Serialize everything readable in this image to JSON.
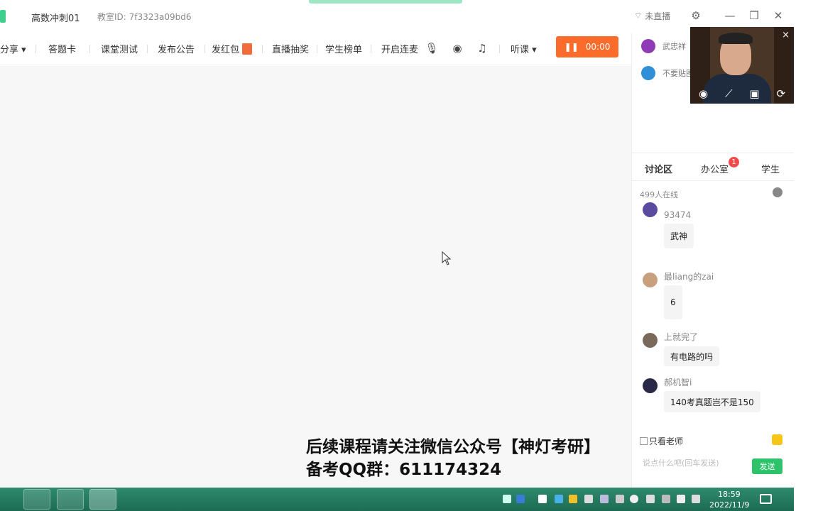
{
  "window": {
    "course_name": "高数冲刺01",
    "room_id": "教室ID: 7f3323a09bd6",
    "live_status": "未直播"
  },
  "toolbar": {
    "share": "分享",
    "answer_card": "答题卡",
    "class_test": "课堂测试",
    "announcement": "发布公告",
    "red_packet": "发红包",
    "lottery": "直播抽奖",
    "leaderboard": "学生榜单",
    "mic_link": "开启连麦",
    "audit": "听课",
    "record_time": "00:00"
  },
  "members": [
    {
      "name": "武忠祥"
    },
    {
      "name": "不要贴图"
    }
  ],
  "tabs": {
    "discussion": "讨论区",
    "office": "办公室",
    "office_badge": "1",
    "students": "学生"
  },
  "online_count": "499人在线",
  "messages": [
    {
      "user": "93474",
      "text": "武神"
    },
    {
      "user": "最liang的zai",
      "text": "6"
    },
    {
      "user": "上就完了",
      "text": "有电路的吗"
    },
    {
      "user": "郝机智i",
      "text": "140考真题岂不是150"
    }
  ],
  "chat": {
    "only_teacher": "只看老师",
    "placeholder": "说点什么吧(回车发送)",
    "send": "发送"
  },
  "overlay": {
    "line1": "后续课程请关注微信公众号【神灯考研】",
    "line2": "备考QQ群：611174324"
  },
  "taskbar": {
    "time": "18:59",
    "date": "2022/11/9"
  },
  "colors": {
    "accent_green": "#2ec36b",
    "record_orange": "#fa6b2c",
    "badge_red": "#f24a4a"
  }
}
